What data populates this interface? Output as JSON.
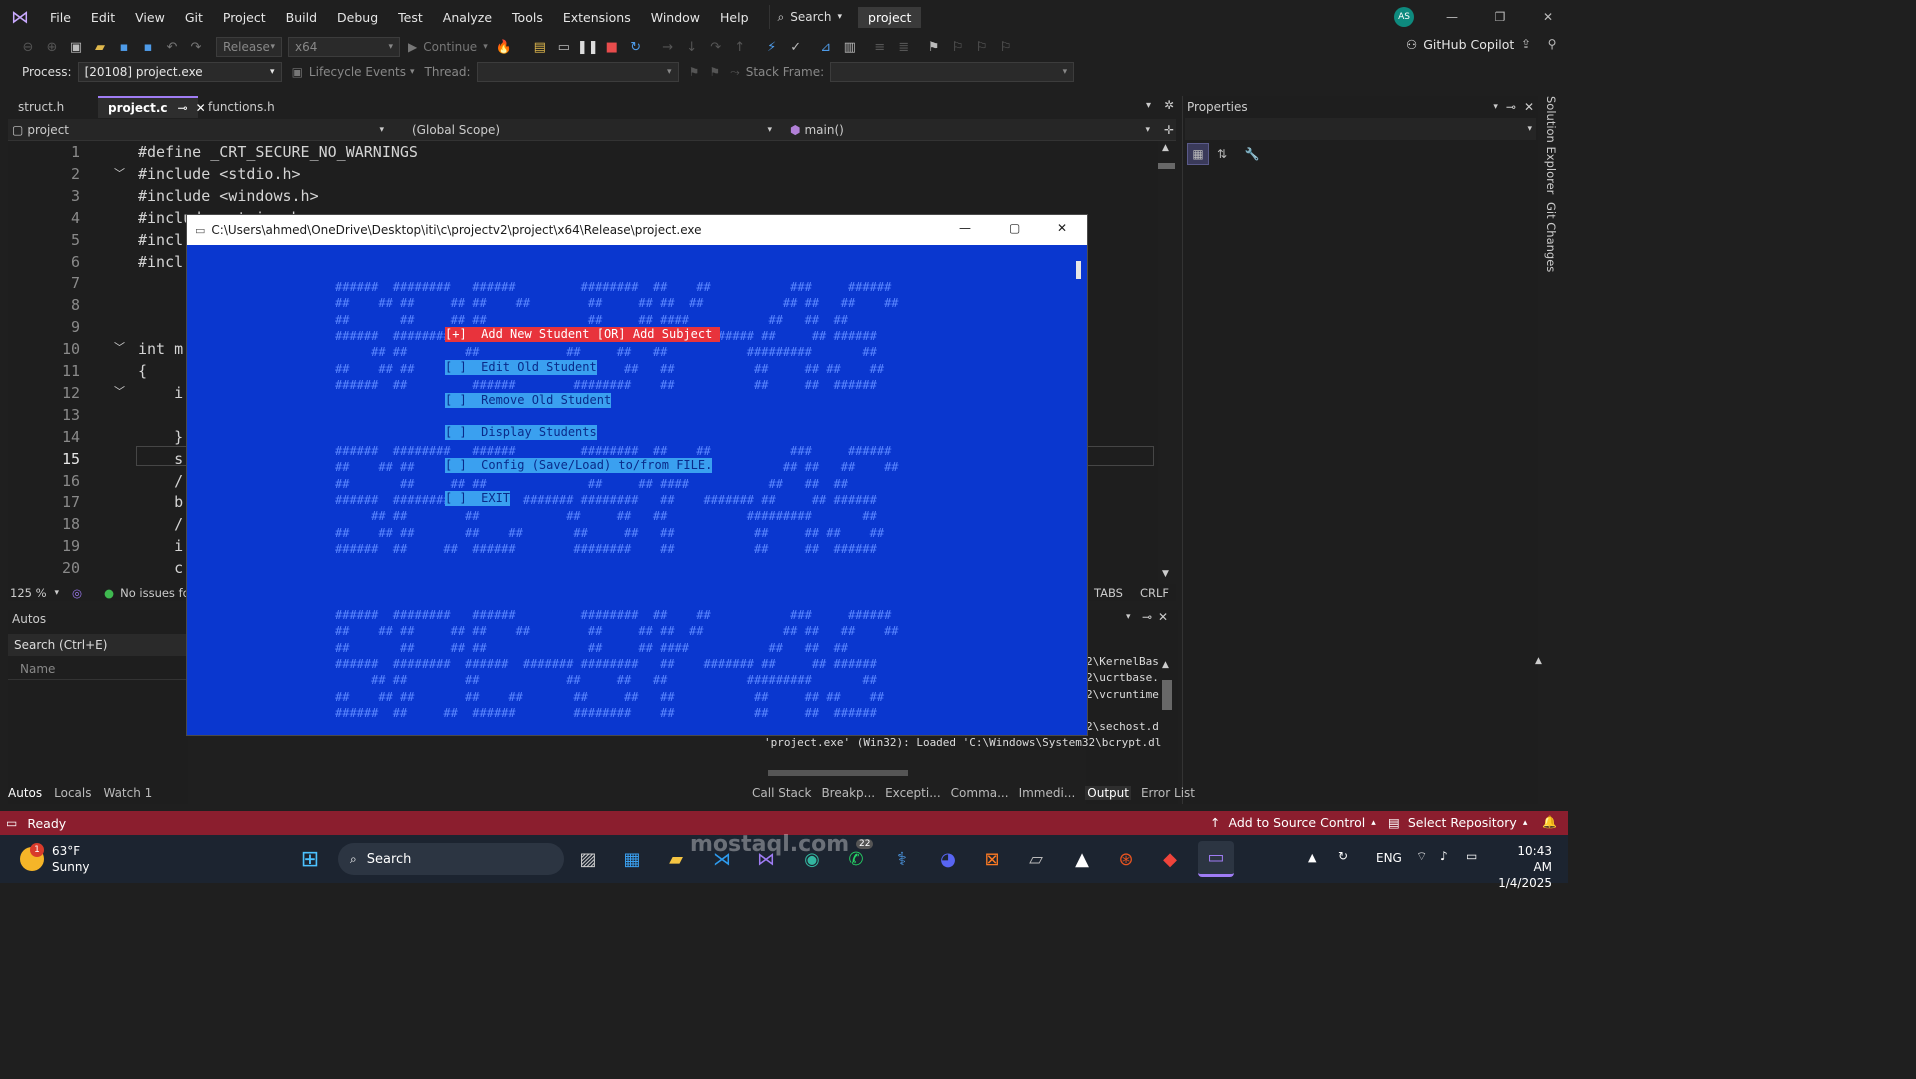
{
  "menubar": {
    "items": [
      "File",
      "Edit",
      "View",
      "Git",
      "Project",
      "Build",
      "Debug",
      "Test",
      "Analyze",
      "Tools",
      "Extensions",
      "Window",
      "Help"
    ],
    "search_label": "Search",
    "project_label": "project",
    "avatar": "AS"
  },
  "toolbar": {
    "config": "Release",
    "platform": "x64",
    "continue": "Continue",
    "copilot": "GitHub Copilot"
  },
  "toolbar2": {
    "process_label": "Process:",
    "process_value": "[20108] project.exe",
    "lifecycle": "Lifecycle Events",
    "thread_label": "Thread:",
    "stackframe_label": "Stack Frame:"
  },
  "editor": {
    "tabs": [
      "struct.h",
      "project.c",
      "functions.h"
    ],
    "nav_project": "project",
    "nav_scope": "(Global Scope)",
    "nav_member": "main()",
    "lines": [
      {
        "n": "1",
        "t": "#define _CRT_SECURE_NO_WARNINGS"
      },
      {
        "n": "2",
        "t": "#include <stdio.h>"
      },
      {
        "n": "3",
        "t": "#include <windows.h>"
      },
      {
        "n": "4",
        "t": "#include <string.h>"
      },
      {
        "n": "5",
        "t": "#incl"
      },
      {
        "n": "6",
        "t": "#incl"
      },
      {
        "n": "7",
        "t": ""
      },
      {
        "n": "8",
        "t": ""
      },
      {
        "n": "9",
        "t": ""
      },
      {
        "n": "10",
        "t": "int m"
      },
      {
        "n": "11",
        "t": "{"
      },
      {
        "n": "12",
        "t": "    i"
      },
      {
        "n": "13",
        "t": ""
      },
      {
        "n": "14",
        "t": "    }"
      },
      {
        "n": "15",
        "t": "    s"
      },
      {
        "n": "16",
        "t": "    /"
      },
      {
        "n": "17",
        "t": "    b"
      },
      {
        "n": "18",
        "t": "    /"
      },
      {
        "n": "19",
        "t": "    i"
      },
      {
        "n": "20",
        "t": "    c"
      }
    ],
    "zoom": "125 %",
    "issues": "No issues fo",
    "tabs_label": "TABS",
    "crlf": "CRLF"
  },
  "properties": {
    "title": "Properties"
  },
  "side_tabs": [
    "Solution Explorer",
    "Git Changes"
  ],
  "autos": {
    "title": "Autos",
    "search": "Search (Ctrl+E)",
    "col_name": "Name"
  },
  "output": {
    "lines": [
      "2\\KernelBas",
      "2\\ucrtbase.",
      "2\\vcruntime",
      "",
      "2\\sechost.d"
    ],
    "loaded_line": "'project.exe' (Win32): Loaded 'C:\\Windows\\System32\\bcrypt.dl"
  },
  "bottom_tabs_left": [
    "Autos",
    "Locals",
    "Watch 1"
  ],
  "bottom_tabs_right": [
    "Call Stack",
    "Breakp...",
    "Excepti...",
    "Comma...",
    "Immedi...",
    "Output",
    "Error List"
  ],
  "statusbar": {
    "ready": "Ready",
    "source_control": "Add to Source Control",
    "repo": "Select Repository"
  },
  "console": {
    "title": "C:\\Users\\ahmed\\OneDrive\\Desktop\\iti\\c\\projectv2\\project\\x64\\Release\\project.exe",
    "options": [
      "[+]  Add New Student [OR] Add Subject ",
      "[ ]  Edit Old Student",
      "[ ]  Remove Old Student",
      "[ ]  Display Students",
      "[ ]  Config (Save/Load) to/from FILE.",
      "[ ]  EXIT"
    ],
    "banner_top": [
      "######  ########   ######         ########  ##    ##           ###     ######",
      "##    ## ##     ## ##    ##        ##     ## ##  ##           ## ##   ##    ##",
      "##       ##     ## ##              ##     ## ####           ##   ##  ##",
      "######  ########  ######  ####### ########   ##    ####### ##     ## ######",
      "     ## ##        ##            ##     ##   ##           #########       ##",
      "##    ## ##       ##    ##       ##     ##   ##           ##     ## ##    ##",
      "######  ##         ######        ########    ##           ##     ##  ######"
    ],
    "banner_mid": [
      "######  ########   ######         ########  ##    ##           ###     ######",
      "##    ## ##     ## ##    ##        ##     ## ##  ##           ## ##   ##    ##",
      "##       ##     ## ##              ##     ## ####           ##   ##  ##",
      "######  ########  ######  ####### ########   ##    ####### ##     ## ######",
      "     ## ##        ##            ##     ##   ##           #########       ##",
      "##    ## ##       ##    ##       ##     ##   ##           ##     ## ##    ##",
      "######  ##     ##  ######        ########    ##           ##     ##  ######"
    ],
    "banner_bot": [
      "######  ########   ######         ########  ##    ##           ###     ######",
      "##    ## ##     ## ##    ##        ##     ## ##  ##           ## ##   ##    ##",
      "##       ##     ## ##              ##     ## ####           ##   ##  ##",
      "######  ########  ######  ####### ########   ##    ####### ##     ## ######",
      "     ## ##        ##            ##     ##   ##           #########       ##",
      "##    ## ##       ##    ##       ##     ##   ##           ##     ## ##    ##",
      "######  ##     ##  ######        ########    ##           ##     ##  ######"
    ]
  },
  "taskbar": {
    "temp": "63°F",
    "weather": "Sunny",
    "search": "Search",
    "lang": "ENG",
    "time": "10:43 AM",
    "date": "1/4/2025",
    "badge": "22",
    "weather_badge": "1"
  },
  "watermark": "mostaql.com"
}
